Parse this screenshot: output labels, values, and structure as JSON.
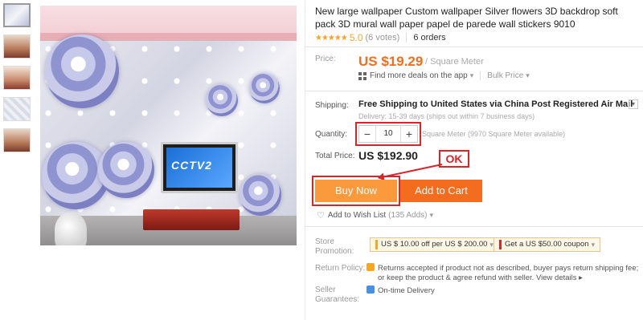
{
  "product": {
    "title": "New large wallpaper Custom wallpaper Silver flowers 3D backdrop soft pack 3D mural wall paper papel de parede wall stickers 9010",
    "stars": "★★★★★",
    "rating": "5.0",
    "votes": "(6 votes)",
    "orders": "6 orders",
    "tv_logo": "CCTV2"
  },
  "price": {
    "label": "Price:",
    "value": "US $19.29",
    "unit": "/ Square Meter",
    "deals": "Find more deals on the app",
    "bulk": "Bulk Price"
  },
  "shipping": {
    "label": "Shipping:",
    "text": "Free Shipping to United States via China Post Registered Air Mail",
    "sub": "Delivery: 15-39 days (ships out within 7 business days)"
  },
  "quantity": {
    "label": "Quantity:",
    "minus": "−",
    "value": "10",
    "plus": "+",
    "unit": "Square Meter (9970 Square Meter available)"
  },
  "total": {
    "label": "Total Price:",
    "value": "US $192.90"
  },
  "annotation": {
    "ok": "OK"
  },
  "actions": {
    "buy": "Buy Now",
    "cart": "Add to Cart",
    "wish": "Add to Wish List",
    "wish_count": "(135 Adds)"
  },
  "promotion": {
    "label_line1": "Store",
    "label_line2": "Promotion:",
    "coupon1": "US $ 10.00 off per US $ 200.00",
    "coupon2": "Get a US $50.00 coupon"
  },
  "return_policy": {
    "label": "Return Policy:",
    "line1": "Returns accepted if product not as described, buyer pays return shipping fee;",
    "line2": "or keep the product & agree refund with seller.",
    "link": "View details ▸"
  },
  "guarantee": {
    "label_line1": "Seller",
    "label_line2": "Guarantees:",
    "text": "On-time Delivery"
  },
  "colors": {
    "price": "#f46c1d",
    "buy": "#fa9a3c",
    "cart": "#f46c1d",
    "annotation": "#d9252a"
  }
}
